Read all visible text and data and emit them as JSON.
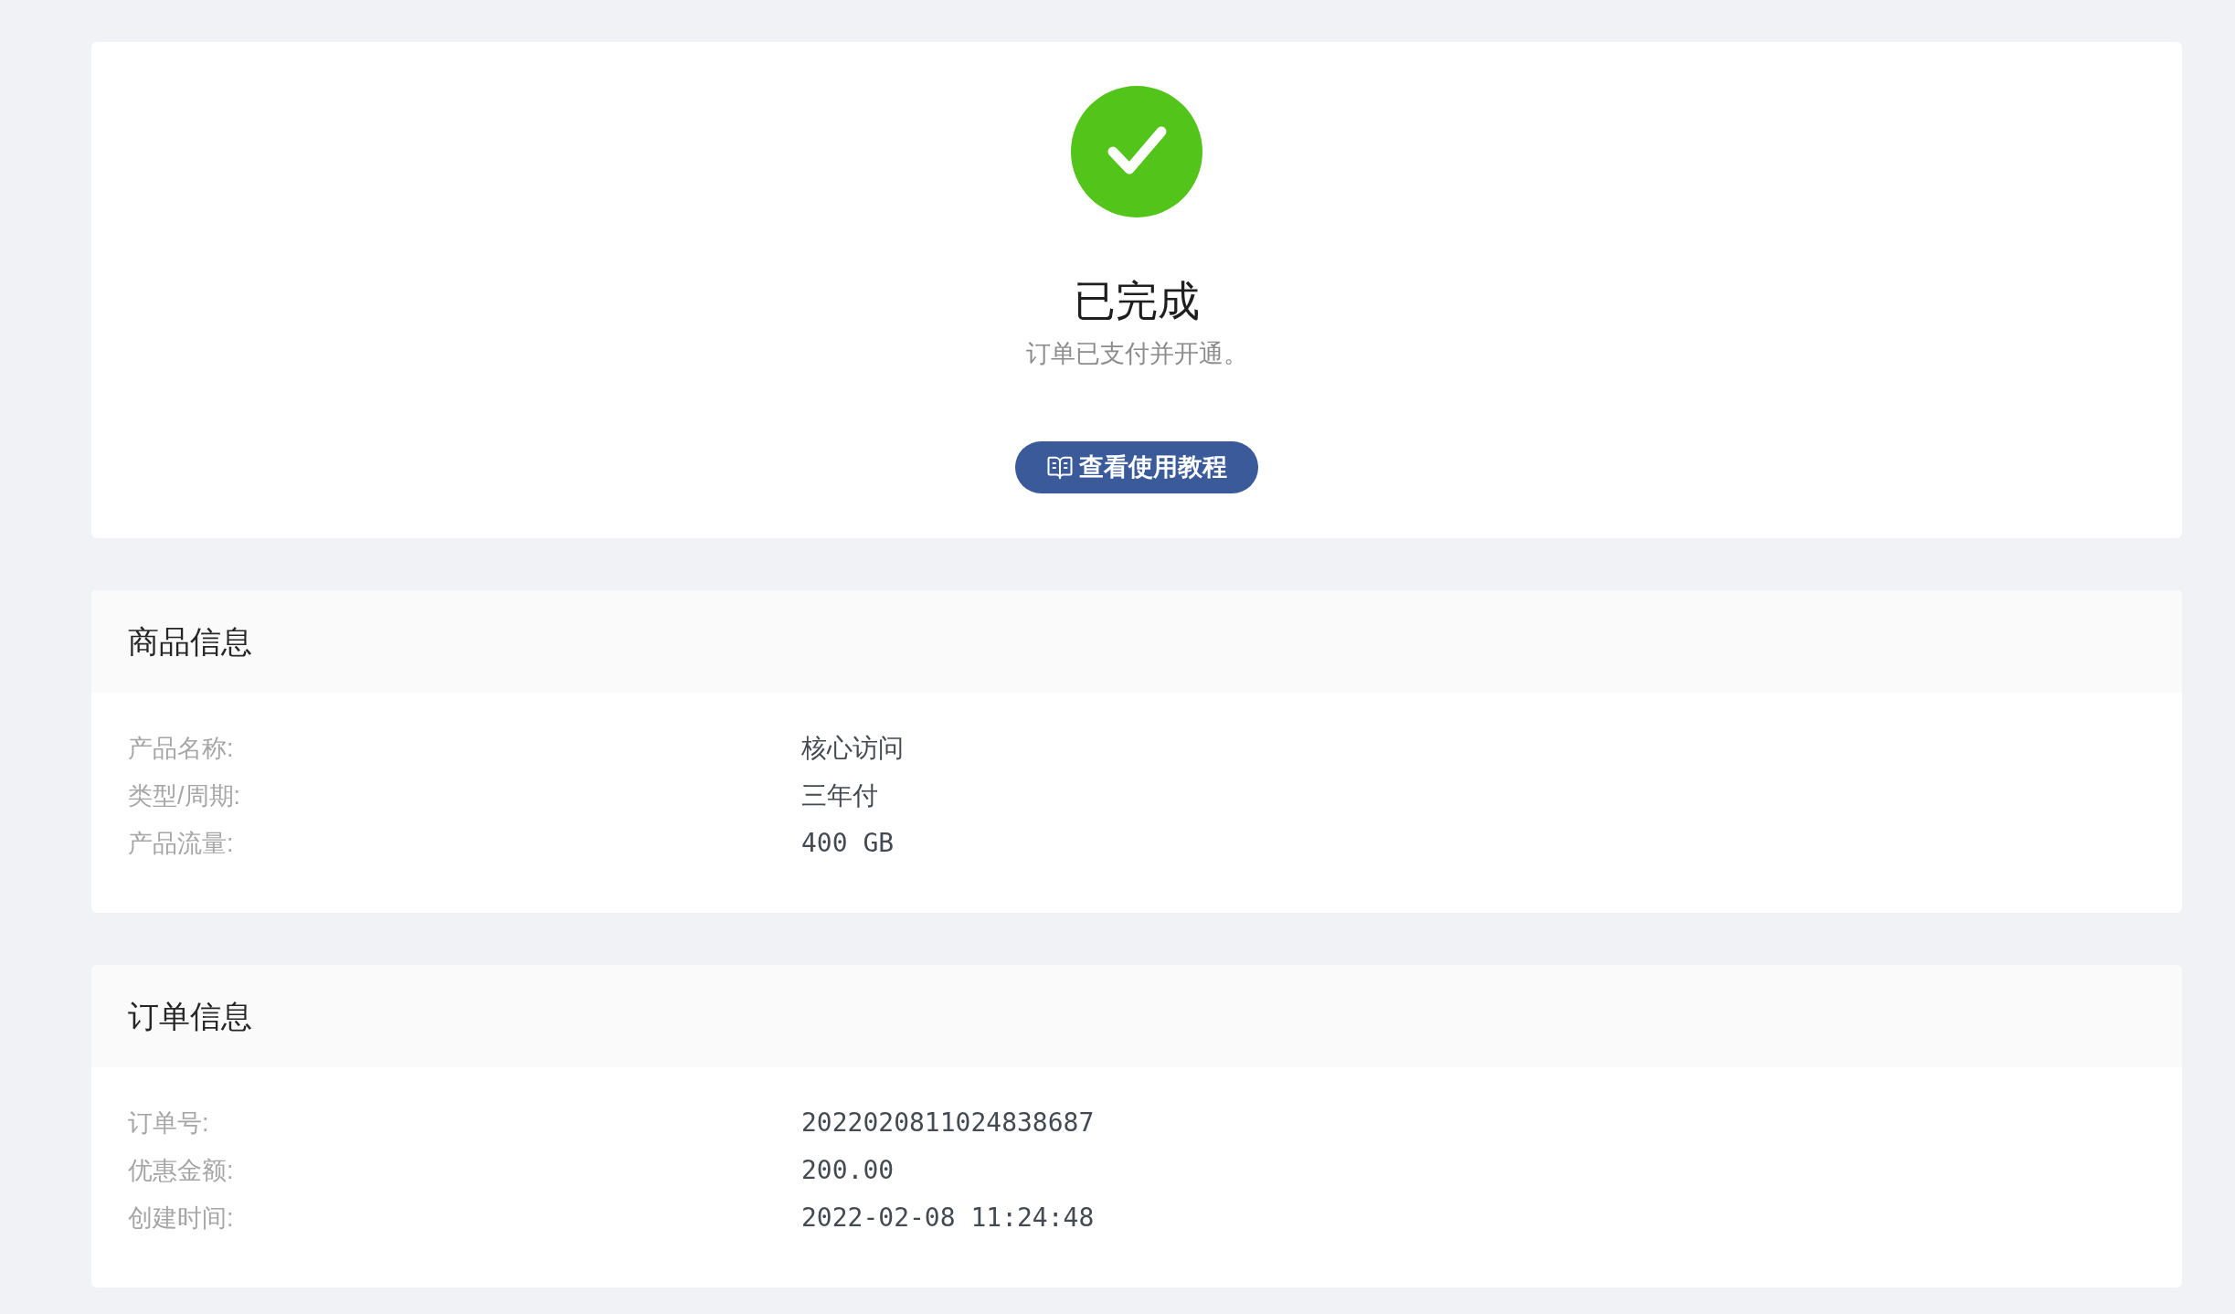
{
  "status": {
    "kind": "success",
    "title": "已完成",
    "message": "订单已支付并开通。"
  },
  "tutorial_button": {
    "label": "查看使用教程"
  },
  "sections": [
    {
      "title": "商品信息",
      "fields": [
        {
          "label": "产品名称:",
          "value": "核心访问"
        },
        {
          "label": "类型/周期:",
          "value": "三年付"
        },
        {
          "label": "产品流量:",
          "value": "400 GB"
        }
      ]
    },
    {
      "title": "订单信息",
      "fields": [
        {
          "label": "订单号:",
          "value": "2022020811024838687"
        },
        {
          "label": "优惠金额:",
          "value": "200.00"
        },
        {
          "label": "创建时间:",
          "value": "2022-02-08 11:24:48"
        }
      ]
    }
  ]
}
